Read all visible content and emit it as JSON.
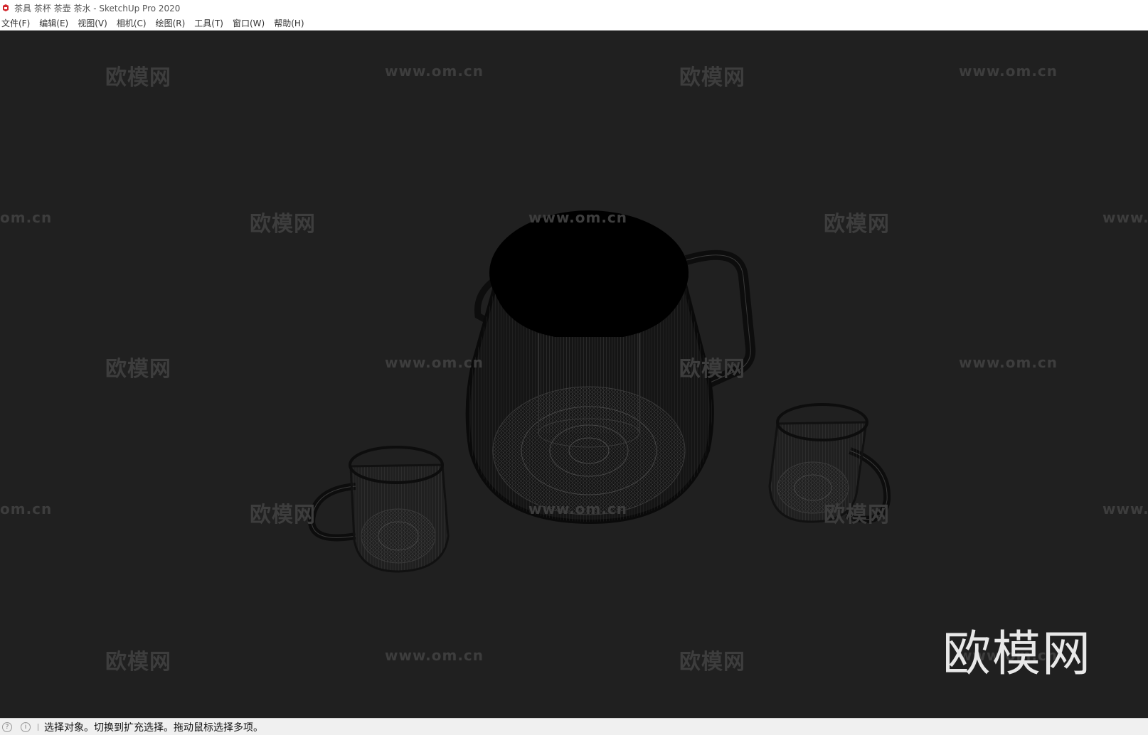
{
  "window": {
    "title": "茶具 茶杯 茶壶 茶水 - SketchUp Pro 2020",
    "app_icon": "sketchup-icon"
  },
  "menubar": {
    "items": [
      "文件(F)",
      "编辑(E)",
      "视图(V)",
      "相机(C)",
      "绘图(R)",
      "工具(T)",
      "窗口(W)",
      "帮助(H)"
    ]
  },
  "viewport": {
    "background": "#202020",
    "model": "teapot-and-two-cups-wireframe",
    "watermark_cn": "欧模网",
    "watermark_url": "www.om.cn",
    "watermark_url_partial_left": "om.cn",
    "watermark_url_partial_right": "www.",
    "logo_text": "欧模网"
  },
  "statusbar": {
    "icons": [
      "question-icon",
      "info-icon"
    ],
    "message": "选择对象。切换到扩充选择。拖动鼠标选择多项。"
  }
}
